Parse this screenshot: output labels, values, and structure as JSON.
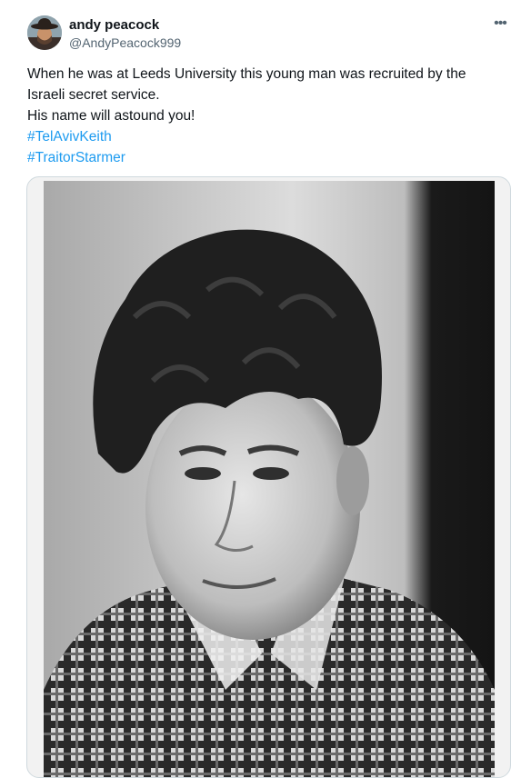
{
  "author": {
    "display_name": "andy peacock",
    "handle": "@AndyPeacock999"
  },
  "menu": {
    "more_label": "•••"
  },
  "tweet": {
    "lines": [
      "When he was at Leeds University this young man was recruited by the",
      "Israeli secret service.",
      "His name will astound you!"
    ],
    "hashtags": [
      "#TelAvivKeith",
      "#TraitorStarmer"
    ]
  },
  "colors": {
    "hashtag": "#1d9bf0",
    "handle": "#536471",
    "border": "#cfd9de"
  }
}
